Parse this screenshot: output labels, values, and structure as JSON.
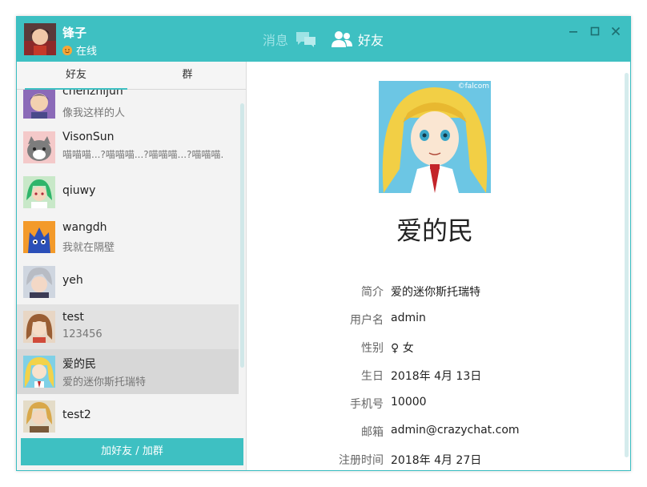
{
  "colors": {
    "accent": "#3ec0c2",
    "status_online": "#f7a637"
  },
  "header": {
    "user_name": "锋子",
    "status": "在线",
    "nav_messages": "消息",
    "nav_friends": "好友",
    "icons": [
      "minimize-icon",
      "maximize-icon",
      "close-icon"
    ]
  },
  "tabs": {
    "friends": "好友",
    "groups": "群"
  },
  "friends": [
    {
      "name": "chenzhijun",
      "signature": "像我这样的人"
    },
    {
      "name": "VisonSun",
      "signature": "喵喵喵...?喵喵喵...?喵喵喵...?喵喵喵."
    },
    {
      "name": "qiuwy",
      "signature": ""
    },
    {
      "name": "wangdh",
      "signature": "我就在隔壁"
    },
    {
      "name": "yeh",
      "signature": ""
    },
    {
      "name": "test",
      "signature": "123456"
    },
    {
      "name": "爱的民",
      "signature": "爱的迷你斯托瑞特"
    },
    {
      "name": "test2",
      "signature": ""
    }
  ],
  "add_button": "加好友 / 加群",
  "profile": {
    "watermark": "©falcom",
    "name": "爱的民",
    "fields": [
      {
        "label": "简介",
        "value": "爱的迷你斯托瑞特"
      },
      {
        "label": "用户名",
        "value": "admin"
      },
      {
        "label": "性别",
        "value": "♀ 女"
      },
      {
        "label": "生日",
        "value": "2018年 4月 13日"
      },
      {
        "label": "手机号",
        "value": "10000"
      },
      {
        "label": "邮箱",
        "value": "admin@crazychat.com"
      },
      {
        "label": "注册时间",
        "value": "2018年 4月 27日"
      }
    ]
  }
}
